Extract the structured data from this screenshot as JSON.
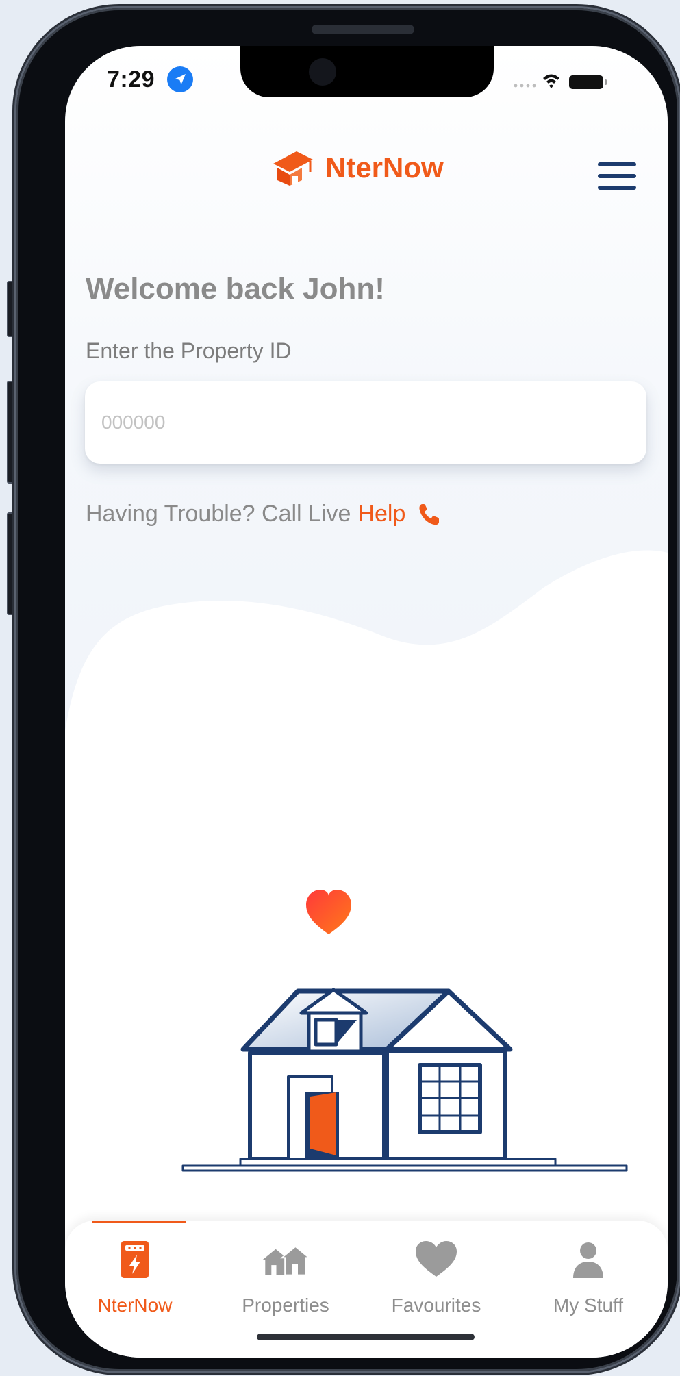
{
  "status_bar": {
    "time": "7:29"
  },
  "header": {
    "brand": "NterNow",
    "logo_icon": "graduation-cap-house-icon",
    "menu_icon": "hamburger-icon"
  },
  "main": {
    "welcome": "Welcome back John!",
    "property_label": "Enter the Property ID",
    "property_placeholder": "000000",
    "property_value": "",
    "help_prefix": "Having Trouble? Call Live",
    "help_link": "Help",
    "help_icon": "phone-icon"
  },
  "tabs": [
    {
      "label": "NterNow",
      "icon": "tablet-bolt-icon",
      "active": true
    },
    {
      "label": "Properties",
      "icon": "houses-icon",
      "active": false
    },
    {
      "label": "Favourites",
      "icon": "heart-icon",
      "active": false
    },
    {
      "label": "My Stuff",
      "icon": "person-icon",
      "active": false
    }
  ],
  "colors": {
    "accent": "#f05a1a",
    "navy": "#1c3b6e",
    "muted_text": "#8a8a8a"
  }
}
